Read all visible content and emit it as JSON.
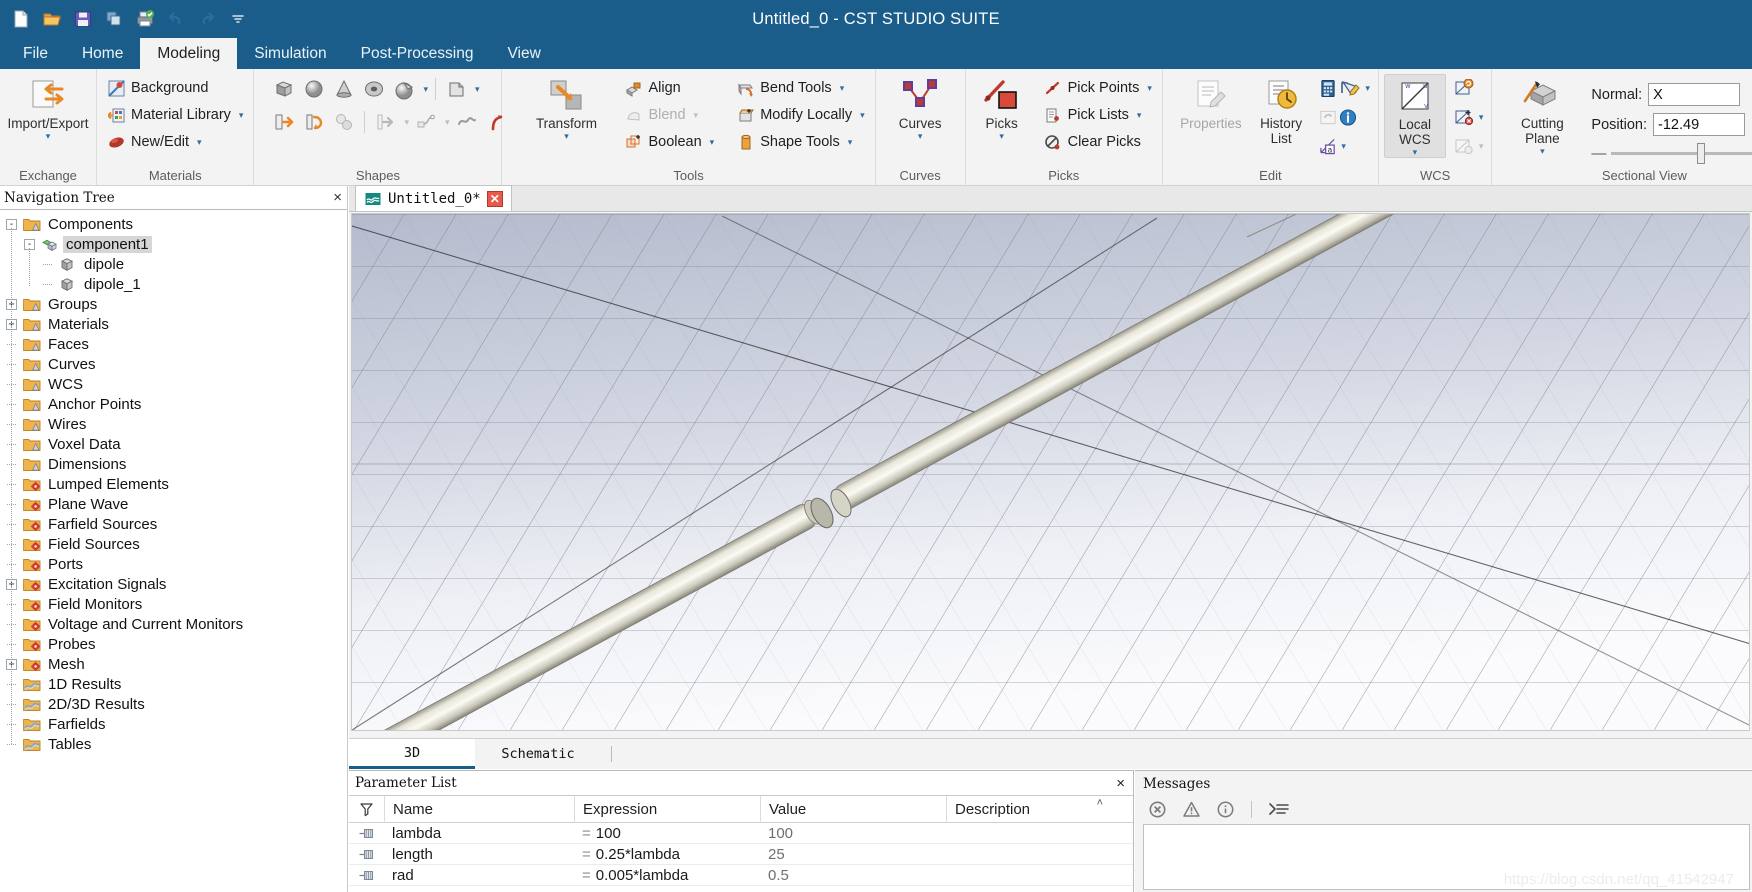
{
  "window": {
    "title": "Untitled_0 - CST STUDIO SUITE",
    "accent": "#1b5d8a"
  },
  "quick_access": [
    {
      "name": "new-document-icon",
      "label": "New"
    },
    {
      "name": "open-folder-icon",
      "label": "Open"
    },
    {
      "name": "save-icon",
      "label": "Save"
    },
    {
      "name": "copy-icon",
      "label": "Copy"
    },
    {
      "name": "print-icon",
      "label": "Print"
    },
    {
      "name": "undo-icon",
      "label": "Undo"
    },
    {
      "name": "redo-icon",
      "label": "Redo"
    },
    {
      "name": "customize-qat-icon",
      "label": "Customize Quick Access Toolbar"
    }
  ],
  "ribbon_tabs": [
    {
      "label": "File",
      "active": false
    },
    {
      "label": "Home",
      "active": false
    },
    {
      "label": "Modeling",
      "active": true
    },
    {
      "label": "Simulation",
      "active": false
    },
    {
      "label": "Post-Processing",
      "active": false
    },
    {
      "label": "View",
      "active": false
    }
  ],
  "ribbon": {
    "groups": [
      {
        "label": "Exchange",
        "big": [
          {
            "label": "Import/Export",
            "caret": true,
            "icon": "import-export-icon"
          }
        ]
      },
      {
        "label": "Materials",
        "small": [
          {
            "label": "Background",
            "icon": "background-icon",
            "caret": false
          },
          {
            "label": "Material Library",
            "icon": "material-library-icon",
            "caret": true
          },
          {
            "label": "New/Edit",
            "icon": "new-edit-material-icon",
            "caret": true
          }
        ]
      },
      {
        "label": "Shapes",
        "shapes_row1": [
          "brick-icon",
          "sphere-icon",
          "cone-icon",
          "torus-icon",
          "ellipsoid-icon",
          "sep",
          "extrude-icon"
        ],
        "shapes_row2": [
          "extrude-face-icon",
          "rotate-face-icon",
          "loft-icon",
          "sep",
          "trace-from-curve-icon",
          "wire-icon",
          "curve-wire-icon",
          "bond-wire-icon"
        ]
      },
      {
        "label": "Tools",
        "big": [
          {
            "label": "Transform",
            "caret": true,
            "icon": "transform-icon"
          }
        ],
        "small": [
          {
            "label": "Align",
            "icon": "align-icon",
            "caret": false
          },
          {
            "label": "Blend",
            "icon": "blend-icon",
            "caret": true,
            "disabled": true
          },
          {
            "label": "Boolean",
            "icon": "boolean-icon",
            "caret": true
          }
        ],
        "small2": [
          {
            "label": "Bend Tools",
            "icon": "bend-tools-icon",
            "caret": true
          },
          {
            "label": "Modify Locally",
            "icon": "modify-locally-icon",
            "caret": true
          },
          {
            "label": "Shape Tools",
            "icon": "shape-tools-icon",
            "caret": true
          }
        ]
      },
      {
        "label": "Curves",
        "big": [
          {
            "label": "Curves",
            "caret": true,
            "icon": "curves-icon"
          }
        ]
      },
      {
        "label": "Picks",
        "big": [
          {
            "label": "Picks",
            "caret": true,
            "icon": "picks-icon"
          }
        ],
        "small": [
          {
            "label": "Pick Points",
            "icon": "pick-points-icon",
            "caret": true
          },
          {
            "label": "Pick Lists",
            "icon": "pick-lists-icon",
            "caret": true
          },
          {
            "label": "Clear Picks",
            "icon": "clear-picks-icon",
            "caret": false
          }
        ]
      },
      {
        "label": "Edit",
        "big": [
          {
            "label": "Properties",
            "caret": false,
            "icon": "properties-icon",
            "disabled": true
          },
          {
            "label": "History\nList",
            "caret": false,
            "icon": "history-list-icon"
          }
        ],
        "icons": [
          "calculator-icon",
          "parametric-update-icon",
          "rename-icon",
          "comment-icon",
          "info-icon",
          "dropdown-caret"
        ]
      },
      {
        "label": "WCS",
        "big": [
          {
            "label": "Local\nWCS",
            "caret": true,
            "icon": "local-wcs-icon",
            "selected": true
          }
        ],
        "icons": [
          "align-wcs-icon",
          "transform-wcs-icon",
          "wcs-properties-icon"
        ]
      },
      {
        "label": "Sectional View",
        "big": [
          {
            "label": "Cutting\nPlane",
            "caret": true,
            "icon": "cutting-plane-icon"
          }
        ],
        "fields": [
          {
            "label": "Normal:",
            "value": "X"
          },
          {
            "label": "Position:",
            "value": "-12.49"
          }
        ]
      }
    ]
  },
  "navigation": {
    "title": "Navigation Tree",
    "close_label": "×",
    "items": [
      {
        "label": "Components",
        "depth": 0,
        "toggle": "-",
        "icon": "folder-shape-icon",
        "selected": false
      },
      {
        "label": "component1",
        "depth": 1,
        "toggle": "-",
        "icon": "component-icon",
        "selected": true
      },
      {
        "label": "dipole",
        "depth": 2,
        "toggle": "",
        "icon": "solid-icon",
        "selected": false
      },
      {
        "label": "dipole_1",
        "depth": 2,
        "toggle": "",
        "icon": "solid-icon",
        "selected": false
      },
      {
        "label": "Groups",
        "depth": 0,
        "toggle": "+",
        "icon": "folder-shape-icon",
        "selected": false
      },
      {
        "label": "Materials",
        "depth": 0,
        "toggle": "+",
        "icon": "folder-shape-icon",
        "selected": false
      },
      {
        "label": "Faces",
        "depth": 0,
        "toggle": "",
        "icon": "folder-shape-icon",
        "selected": false
      },
      {
        "label": "Curves",
        "depth": 0,
        "toggle": "",
        "icon": "folder-shape-icon",
        "selected": false
      },
      {
        "label": "WCS",
        "depth": 0,
        "toggle": "",
        "icon": "folder-shape-icon",
        "selected": false
      },
      {
        "label": "Anchor Points",
        "depth": 0,
        "toggle": "",
        "icon": "folder-shape-icon",
        "selected": false
      },
      {
        "label": "Wires",
        "depth": 0,
        "toggle": "",
        "icon": "folder-shape-icon",
        "selected": false
      },
      {
        "label": "Voxel Data",
        "depth": 0,
        "toggle": "",
        "icon": "folder-shape-icon",
        "selected": false
      },
      {
        "label": "Dimensions",
        "depth": 0,
        "toggle": "",
        "icon": "folder-shape-icon",
        "selected": false
      },
      {
        "label": "Lumped Elements",
        "depth": 0,
        "toggle": "",
        "icon": "folder-gear-icon",
        "selected": false
      },
      {
        "label": "Plane Wave",
        "depth": 0,
        "toggle": "",
        "icon": "folder-gear-icon",
        "selected": false
      },
      {
        "label": "Farfield Sources",
        "depth": 0,
        "toggle": "",
        "icon": "folder-gear-icon",
        "selected": false
      },
      {
        "label": "Field Sources",
        "depth": 0,
        "toggle": "",
        "icon": "folder-gear-icon",
        "selected": false
      },
      {
        "label": "Ports",
        "depth": 0,
        "toggle": "",
        "icon": "folder-gear-icon",
        "selected": false
      },
      {
        "label": "Excitation Signals",
        "depth": 0,
        "toggle": "+",
        "icon": "folder-gear-icon",
        "selected": false
      },
      {
        "label": "Field Monitors",
        "depth": 0,
        "toggle": "",
        "icon": "folder-gear-icon",
        "selected": false
      },
      {
        "label": "Voltage and Current Monitors",
        "depth": 0,
        "toggle": "",
        "icon": "folder-gear-icon",
        "selected": false
      },
      {
        "label": "Probes",
        "depth": 0,
        "toggle": "",
        "icon": "folder-gear-icon",
        "selected": false
      },
      {
        "label": "Mesh",
        "depth": 0,
        "toggle": "+",
        "icon": "folder-gear-icon",
        "selected": false
      },
      {
        "label": "1D Results",
        "depth": 0,
        "toggle": "",
        "icon": "folder-results-icon",
        "selected": false
      },
      {
        "label": "2D/3D Results",
        "depth": 0,
        "toggle": "",
        "icon": "folder-results-icon",
        "selected": false
      },
      {
        "label": "Farfields",
        "depth": 0,
        "toggle": "",
        "icon": "folder-results-icon",
        "selected": false
      },
      {
        "label": "Tables",
        "depth": 0,
        "toggle": "",
        "icon": "folder-results-icon",
        "selected": false
      }
    ]
  },
  "document_tab": {
    "label": "Untitled_0*",
    "icon": "cst-project-icon",
    "close_label": "✕"
  },
  "view_tabs": [
    {
      "label": "3D",
      "active": true
    },
    {
      "label": "Schematic",
      "active": false
    }
  ],
  "parameter_list": {
    "title": "Parameter List",
    "close_label": "×",
    "filter_icon": "filter-icon",
    "columns": [
      "",
      "Name",
      "Expression",
      "Value",
      "Description"
    ],
    "sort_indicator": "˄",
    "rows": [
      {
        "icon": "param-row-icon",
        "name": "lambda",
        "expression": "100",
        "value": "100",
        "description": ""
      },
      {
        "icon": "param-row-icon",
        "name": "length",
        "expression": "0.25*lambda",
        "value": "25",
        "description": ""
      },
      {
        "icon": "param-row-icon",
        "name": "rad",
        "expression": "0.005*lambda",
        "value": "0.5",
        "description": ""
      }
    ]
  },
  "messages": {
    "title": "Messages",
    "toolbar": [
      {
        "name": "errors-filter-icon",
        "label": "Errors"
      },
      {
        "name": "warnings-filter-icon",
        "label": "Warnings"
      },
      {
        "name": "info-filter-icon",
        "label": "Information"
      },
      {
        "name": "clear-messages-icon",
        "label": "Clear Messages"
      }
    ],
    "body_text": ""
  },
  "watermark": "https://blog.csdn.net/qq_41542947"
}
